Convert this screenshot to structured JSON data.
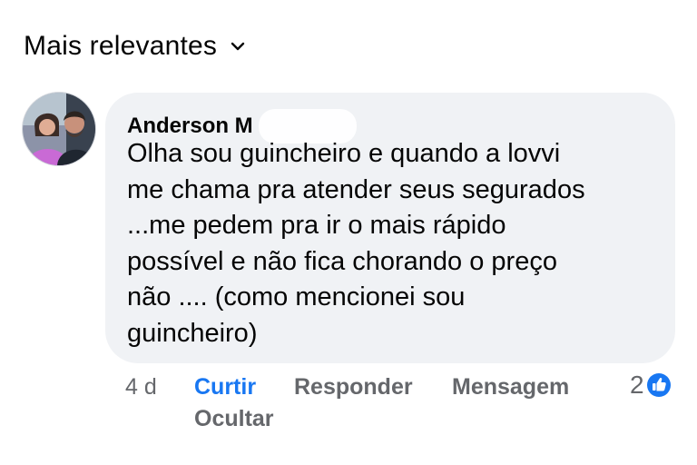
{
  "sort": {
    "label": "Mais relevantes"
  },
  "comment": {
    "author": "Anderson M",
    "text": "Olha sou guincheiro  e quando a lovvi\nme chama pra atender seus segurados\n...me pedem pra ir o mais rápido\npossível e não fica chorando o preço\nnão  ....  (como mencionei sou\nguincheiro)",
    "time": "4 d",
    "reaction_count": "2"
  },
  "actions": {
    "like": "Curtir",
    "reply": "Responder",
    "message": "Mensagem",
    "hide": "Ocultar"
  },
  "icons": {
    "sort": "chevron-down-icon",
    "avatar": "profile-avatar",
    "reaction": "like-reaction-icon"
  },
  "colors": {
    "bubble": "#f0f2f5",
    "accent": "#1877f2",
    "secondary_text": "#65676b",
    "text": "#050505"
  }
}
